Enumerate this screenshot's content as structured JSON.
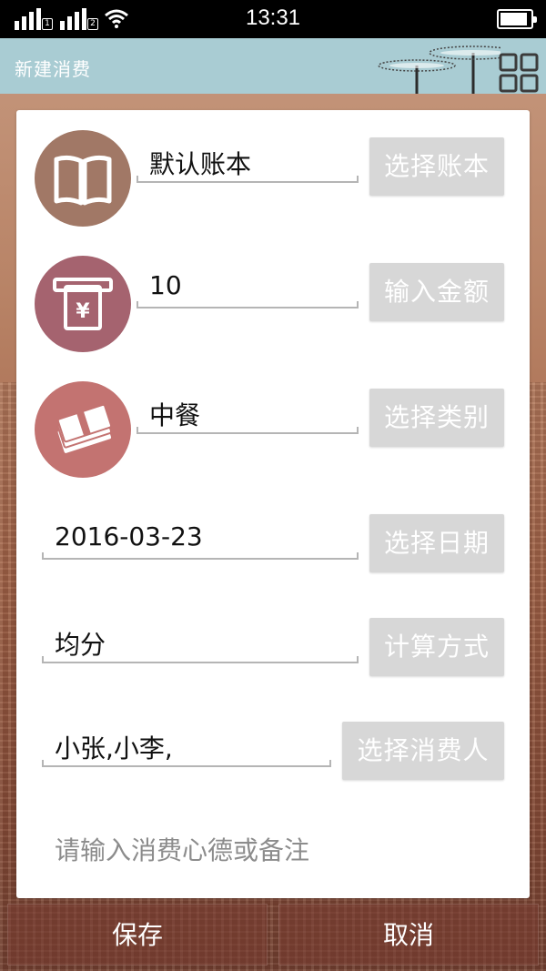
{
  "status_bar": {
    "time": "13:31",
    "sim1": "1",
    "sim2": "2",
    "battery_level": 0.9
  },
  "header": {
    "title": "新建消费",
    "menu_icon": "grid-icon"
  },
  "form": {
    "account_book": {
      "icon": "book-icon",
      "icon_color": "#a17866",
      "value": "默认账本",
      "button": "选择账本"
    },
    "amount": {
      "icon": "atm-yen-icon",
      "icon_color": "#a5636f",
      "value": "10",
      "button": "输入金额"
    },
    "category": {
      "icon": "cash-stack-icon",
      "icon_color": "#c37371",
      "value": "中餐",
      "button": "选择类别"
    },
    "date": {
      "value": "2016-03-23",
      "button": "选择日期"
    },
    "split_method": {
      "value": "均分",
      "button": "计算方式"
    },
    "participants": {
      "value": "小张,小李,",
      "button": "选择消费人"
    },
    "notes_placeholder": "请输入消费心德或备注"
  },
  "actions": {
    "save": "保存",
    "cancel": "取消"
  },
  "colors": {
    "title_bar": "#a9ccd3",
    "button_bg": "#d7d7d7"
  }
}
